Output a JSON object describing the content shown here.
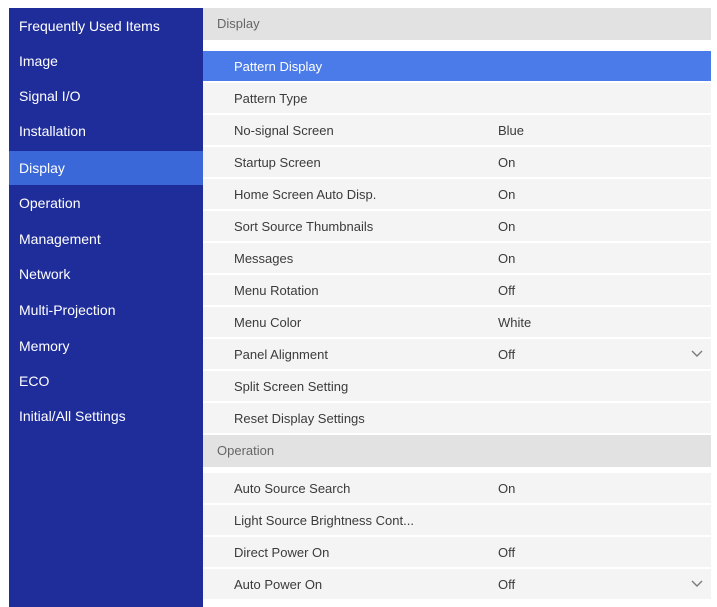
{
  "sidebar": {
    "items": [
      {
        "label": "Frequently Used Items"
      },
      {
        "label": "Image"
      },
      {
        "label": "Signal I/O"
      },
      {
        "label": "Installation"
      },
      {
        "label": "Display"
      },
      {
        "label": "Operation"
      },
      {
        "label": "Management"
      },
      {
        "label": "Network"
      },
      {
        "label": "Multi-Projection"
      },
      {
        "label": "Memory"
      },
      {
        "label": "ECO"
      },
      {
        "label": "Initial/All Settings"
      }
    ],
    "selected": "Display"
  },
  "main": {
    "display_section": {
      "header": "Display",
      "rows": [
        {
          "label": "Pattern Display",
          "value": ""
        },
        {
          "label": "Pattern Type",
          "value": ""
        },
        {
          "label": "No-signal Screen",
          "value": "Blue"
        },
        {
          "label": "Startup Screen",
          "value": "On"
        },
        {
          "label": "Home Screen Auto Disp.",
          "value": "On"
        },
        {
          "label": "Sort Source Thumbnails",
          "value": "On"
        },
        {
          "label": "Messages",
          "value": "On"
        },
        {
          "label": "Menu Rotation",
          "value": "Off"
        },
        {
          "label": "Menu Color",
          "value": "White"
        },
        {
          "label": "Panel Alignment",
          "value": "Off"
        },
        {
          "label": "Split Screen Setting",
          "value": ""
        },
        {
          "label": "Reset Display Settings",
          "value": ""
        }
      ]
    },
    "operation_section": {
      "header": "Operation",
      "rows": [
        {
          "label": "Auto Source Search",
          "value": "On"
        },
        {
          "label": "Light Source Brightness Cont...",
          "value": ""
        },
        {
          "label": "Direct Power On",
          "value": "Off"
        },
        {
          "label": "Auto Power On",
          "value": "Off"
        }
      ]
    }
  },
  "colors": {
    "sidebar_bg": "#1f2d9a",
    "sidebar_selected": "#3b68d8",
    "row_selected": "#4b7be8",
    "row_bg": "#f4f4f4",
    "section_header_bg": "#e2e2e2"
  }
}
